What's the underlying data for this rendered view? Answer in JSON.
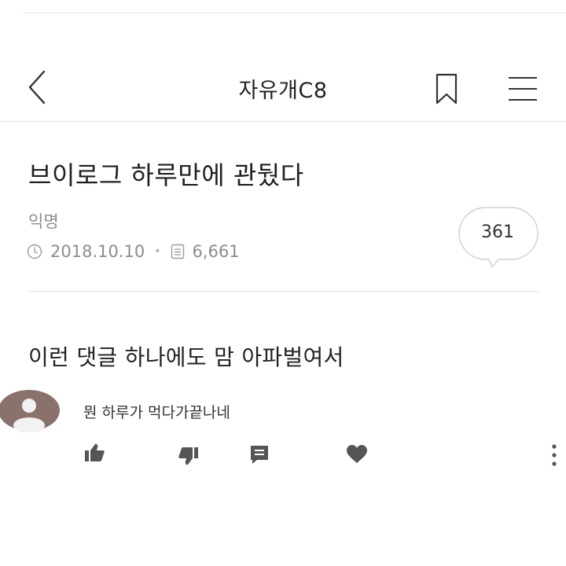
{
  "header": {
    "title": "자유개C8",
    "back_icon": "chevron-left-icon",
    "bookmark_icon": "bookmark-icon",
    "menu_icon": "hamburger-menu-icon"
  },
  "post": {
    "title": "브이로그 하루만에 관뒀다",
    "author": "익명",
    "date": "2018.10.10",
    "date_icon": "clock-icon",
    "views": "6,661",
    "views_icon": "document-icon",
    "comment_count": "361",
    "body": "이런 댓글 하나에도 맘 아파벌여서"
  },
  "comment": {
    "text": "뭔 하루가 먹다가끝나네",
    "actions": [
      "thumbs-up-icon",
      "thumbs-down-icon",
      "reply-icon",
      "heart-icon",
      "more-vertical-icon"
    ]
  },
  "colors": {
    "text": "#222222",
    "muted": "#8c8c8c",
    "divider": "#e4e4e4",
    "icon": "#555555",
    "avatar": "#8a716c"
  }
}
